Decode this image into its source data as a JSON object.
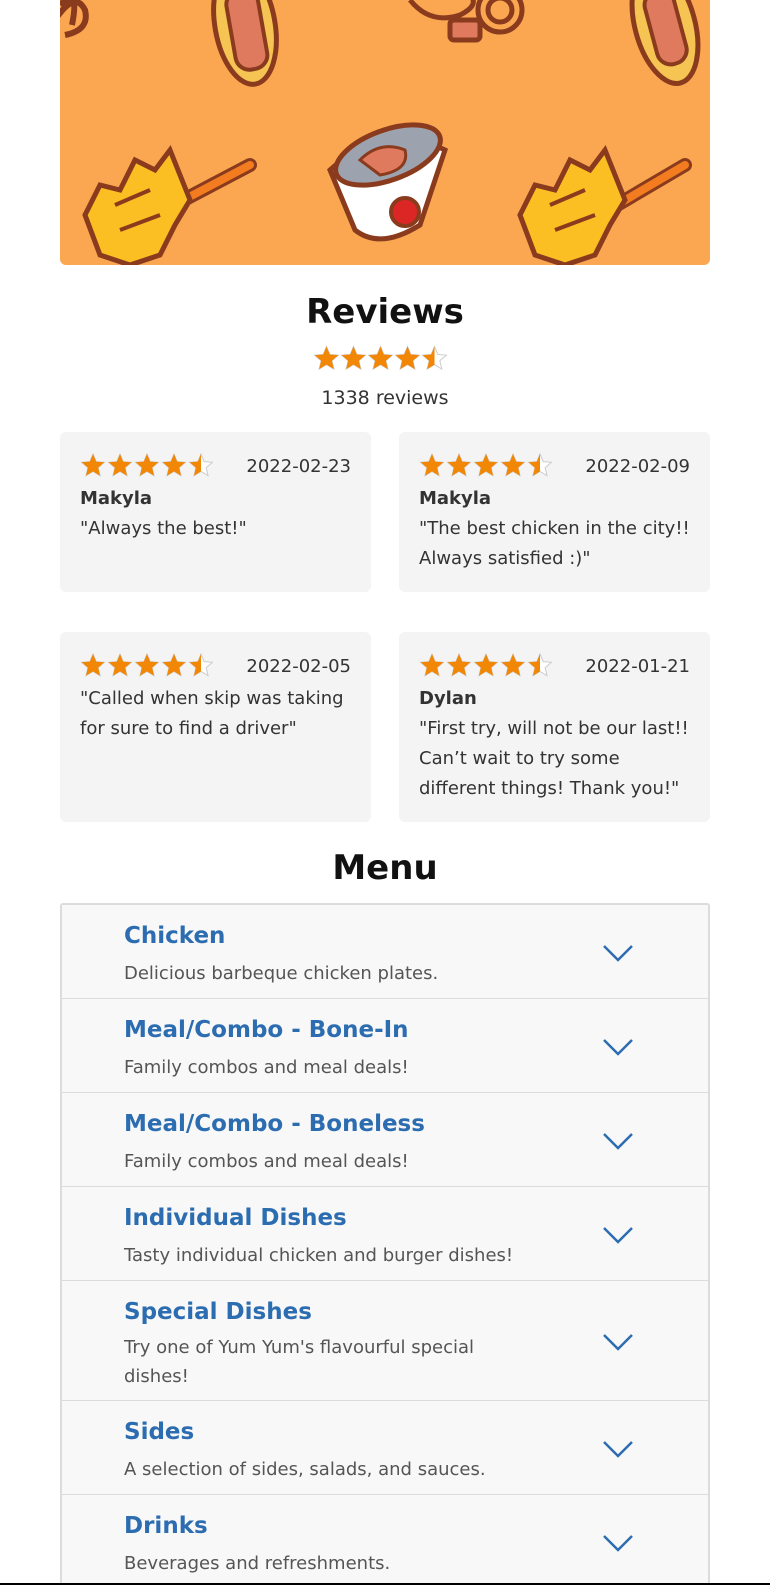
{
  "colors": {
    "banner_bg": "#fba752",
    "star": "#f28705",
    "menu_name": "#2c6cb0",
    "card_bg": "#f4f4f4"
  },
  "reviews": {
    "title": "Reviews",
    "rating": 4.5,
    "count_text": "1338 reviews",
    "items": [
      {
        "rating": 4.5,
        "date": "2022-02-23",
        "author": "Makyla",
        "text": "\"Always the best!\""
      },
      {
        "rating": 4.5,
        "date": "2022-02-09",
        "author": "Makyla",
        "text": "\"The best chicken in the city!! Always satisfied :)\""
      },
      {
        "rating": 4.5,
        "date": "2022-02-05",
        "author": "",
        "text": "\"Called when skip was taking for sure to find a driver\""
      },
      {
        "rating": 4.5,
        "date": "2022-01-21",
        "author": "Dylan",
        "text": "\"First try, will not be our last!! Can’t wait to try some different things! Thank you!\""
      }
    ]
  },
  "menu": {
    "title": "Menu",
    "categories": [
      {
        "name": "Chicken",
        "description": "Delicious barbeque chicken plates."
      },
      {
        "name": "Meal/Combo - Bone-In",
        "description": "Family combos and meal deals!"
      },
      {
        "name": "Meal/Combo - Boneless",
        "description": "Family combos and meal deals!"
      },
      {
        "name": "Individual Dishes",
        "description": "Tasty individual chicken and burger dishes!"
      },
      {
        "name": "Special Dishes",
        "description": "Try one of Yum Yum's flavourful special dishes!"
      },
      {
        "name": "Sides",
        "description": "A selection of sides, salads, and sauces."
      },
      {
        "name": "Drinks",
        "description": "Beverages and refreshments."
      }
    ]
  }
}
